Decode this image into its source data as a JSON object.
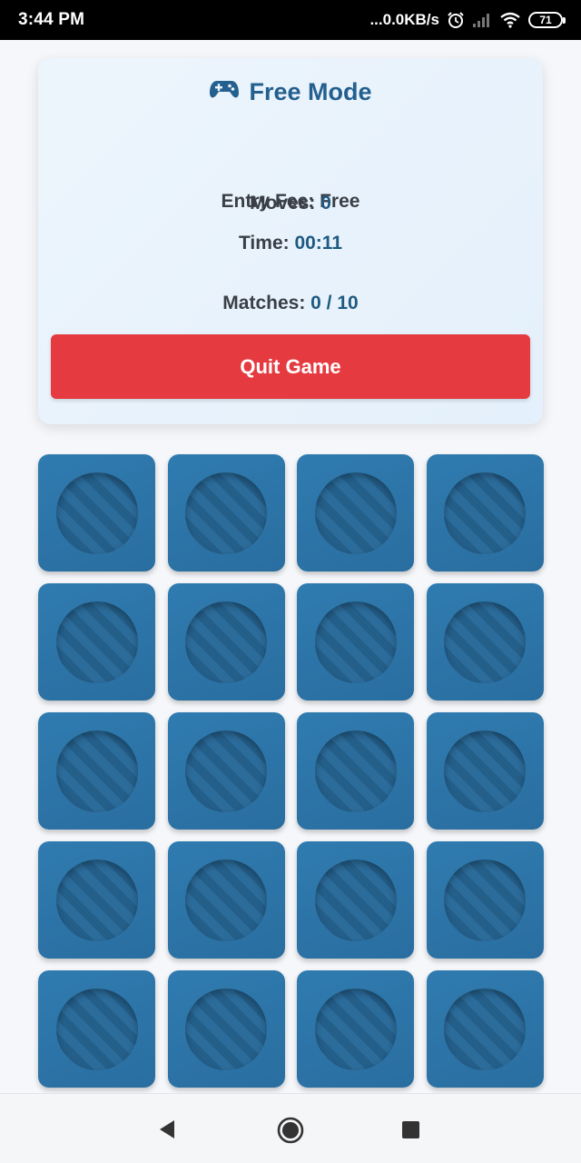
{
  "status_bar": {
    "time": "3:44 PM",
    "network_speed": "...0.0KB/s",
    "battery": "71"
  },
  "game": {
    "mode_title": "Free Mode",
    "mode_icon": "gamepad-icon",
    "entry_fee_label": "Entry Fee: Free",
    "moves_label": "Moves: ",
    "moves_value": "0",
    "time_label": "Time: ",
    "time_value": "00:11",
    "matches_label": "Matches: ",
    "matches_value": "0 / 10",
    "quit_label": "Quit Game"
  },
  "colors": {
    "accent": "#23608f",
    "quit_button": "#e53b40",
    "card_back": "#2f7bb0"
  },
  "board": {
    "columns": 4,
    "card_count": 20,
    "card_state": "face-down"
  },
  "nav_bar": {
    "icons": [
      "back-icon",
      "home-icon",
      "recents-icon"
    ]
  }
}
